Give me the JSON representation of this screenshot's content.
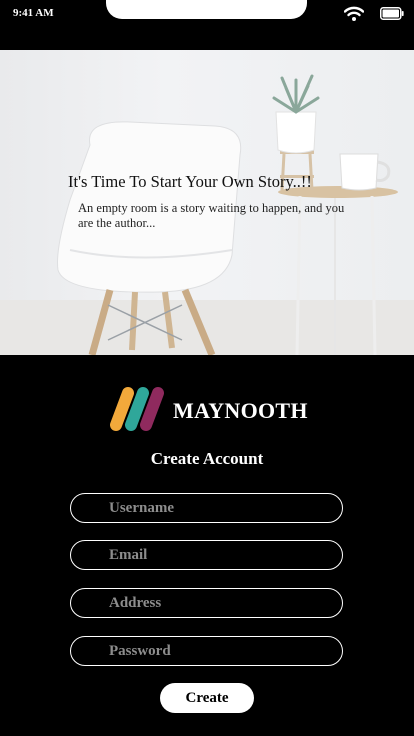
{
  "status_bar": {
    "time": "9:41 AM"
  },
  "hero": {
    "title": "It's Time To Start Your Own Story..!!",
    "subtitle": "An empty room is a story waiting to happen, and you are the author..."
  },
  "brand": {
    "name": "MAYNOOTH",
    "colors": [
      "#f2a93b",
      "#2fa79a",
      "#8f2a5e"
    ]
  },
  "form": {
    "heading": "Create Account",
    "username_placeholder": "Username",
    "email_placeholder": "Email",
    "address_placeholder": "Address",
    "password_placeholder": "Password",
    "submit_label": "Create"
  }
}
